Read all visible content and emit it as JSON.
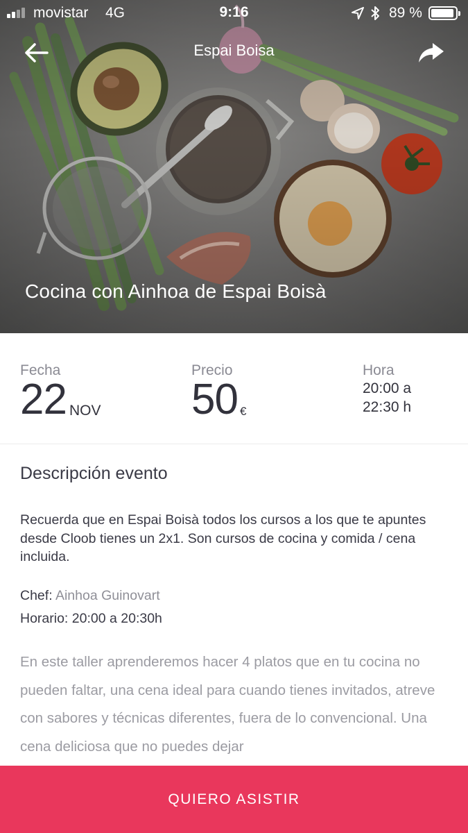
{
  "status_bar": {
    "carrier": "movistar",
    "network": "4G",
    "time": "9:16",
    "battery_percent": "89 %",
    "battery_level": 0.89,
    "signal_bars_filled": 2,
    "icons": [
      "location-arrow-icon",
      "bluetooth-icon",
      "battery-icon"
    ]
  },
  "nav": {
    "back_icon": "arrow-left-icon",
    "title": "Espai Boisa",
    "share_icon": "share-arrow-icon"
  },
  "hero": {
    "event_title": "Cocina con Ainhoa de Espai Boisà"
  },
  "info": {
    "date_label": "Fecha",
    "date_day": "22",
    "date_month": "NOV",
    "price_label": "Precio",
    "price_value": "50",
    "price_currency": "€",
    "hour_label": "Hora",
    "hour_start": "20:00 a",
    "hour_end": "22:30 h"
  },
  "description": {
    "section_title": "Descripción evento",
    "intro": "Recuerda que en Espai Boisà todos los cursos a los que te apuntes desde Cloob tienes un 2x1. Son cursos de cocina y comida / cena incluida.",
    "chef_label": "Chef:",
    "chef_name": "Ainhoa Guinovart",
    "schedule": "Horario: 20:00 a 20:30h",
    "long_text": "En este taller aprenderemos hacer 4 platos que en tu cocina no pueden faltar, una cena ideal para cuando tienes invitados, atreve con sabores y técnicas diferentes, fuera de lo convencional. Una cena deliciosa que no puedes dejar"
  },
  "cta": {
    "label": "QUIERO ASISTIR"
  },
  "colors": {
    "accent": "#e9375c",
    "text_dark": "#32323c",
    "text_muted": "#8a8a93"
  }
}
